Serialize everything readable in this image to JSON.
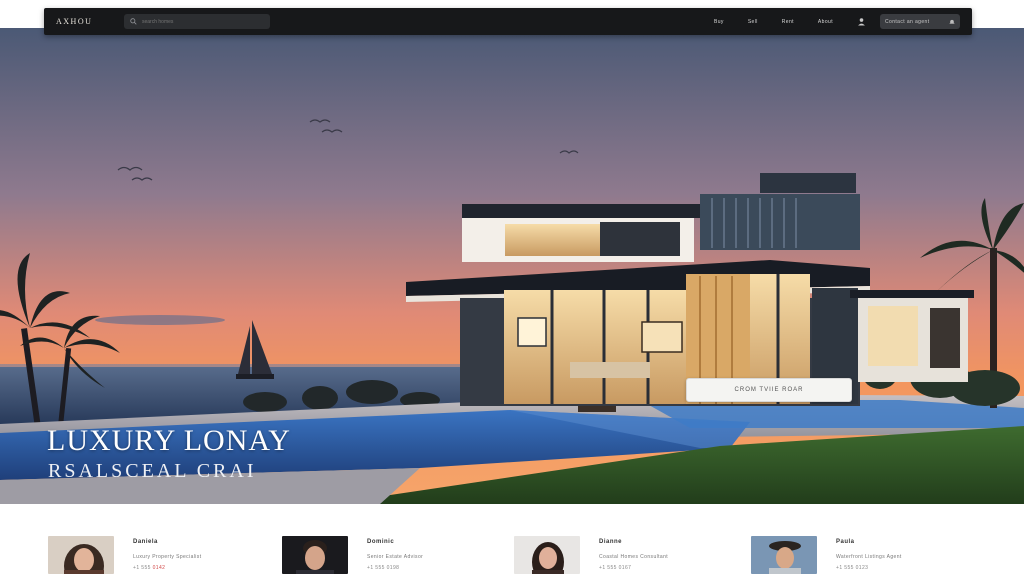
{
  "header": {
    "brand": "AXHOU",
    "search_placeholder": "search homes",
    "nav": [
      "Buy",
      "Sell",
      "Rent",
      "About"
    ],
    "cta_label": "Contact an agent"
  },
  "hero": {
    "title": "LUXURY LONAY",
    "subtitle": "RSALSCEAL CRAI",
    "button_label": "CROM TVIIE ROAR"
  },
  "agents": [
    {
      "name": "Daniela",
      "role": "Luxury Property Specialist",
      "phone": "+1 555 ",
      "phone_accent": "0142"
    },
    {
      "name": "Dominic",
      "role": "Senior Estate Advisor",
      "phone": "+1 555 0198"
    },
    {
      "name": "Dianne",
      "role": "Coastal Homes Consultant",
      "phone": "+1 555 0167"
    },
    {
      "name": "Paula",
      "role": "Waterfront Listings Agent",
      "phone": "+1 555 0123"
    }
  ],
  "colors": {
    "nav_bg": "#17181a",
    "sky_top": "#4b5975",
    "sky_bottom": "#f08a5d",
    "pool": "#2c5a9e",
    "lawn": "#2c4f24"
  }
}
